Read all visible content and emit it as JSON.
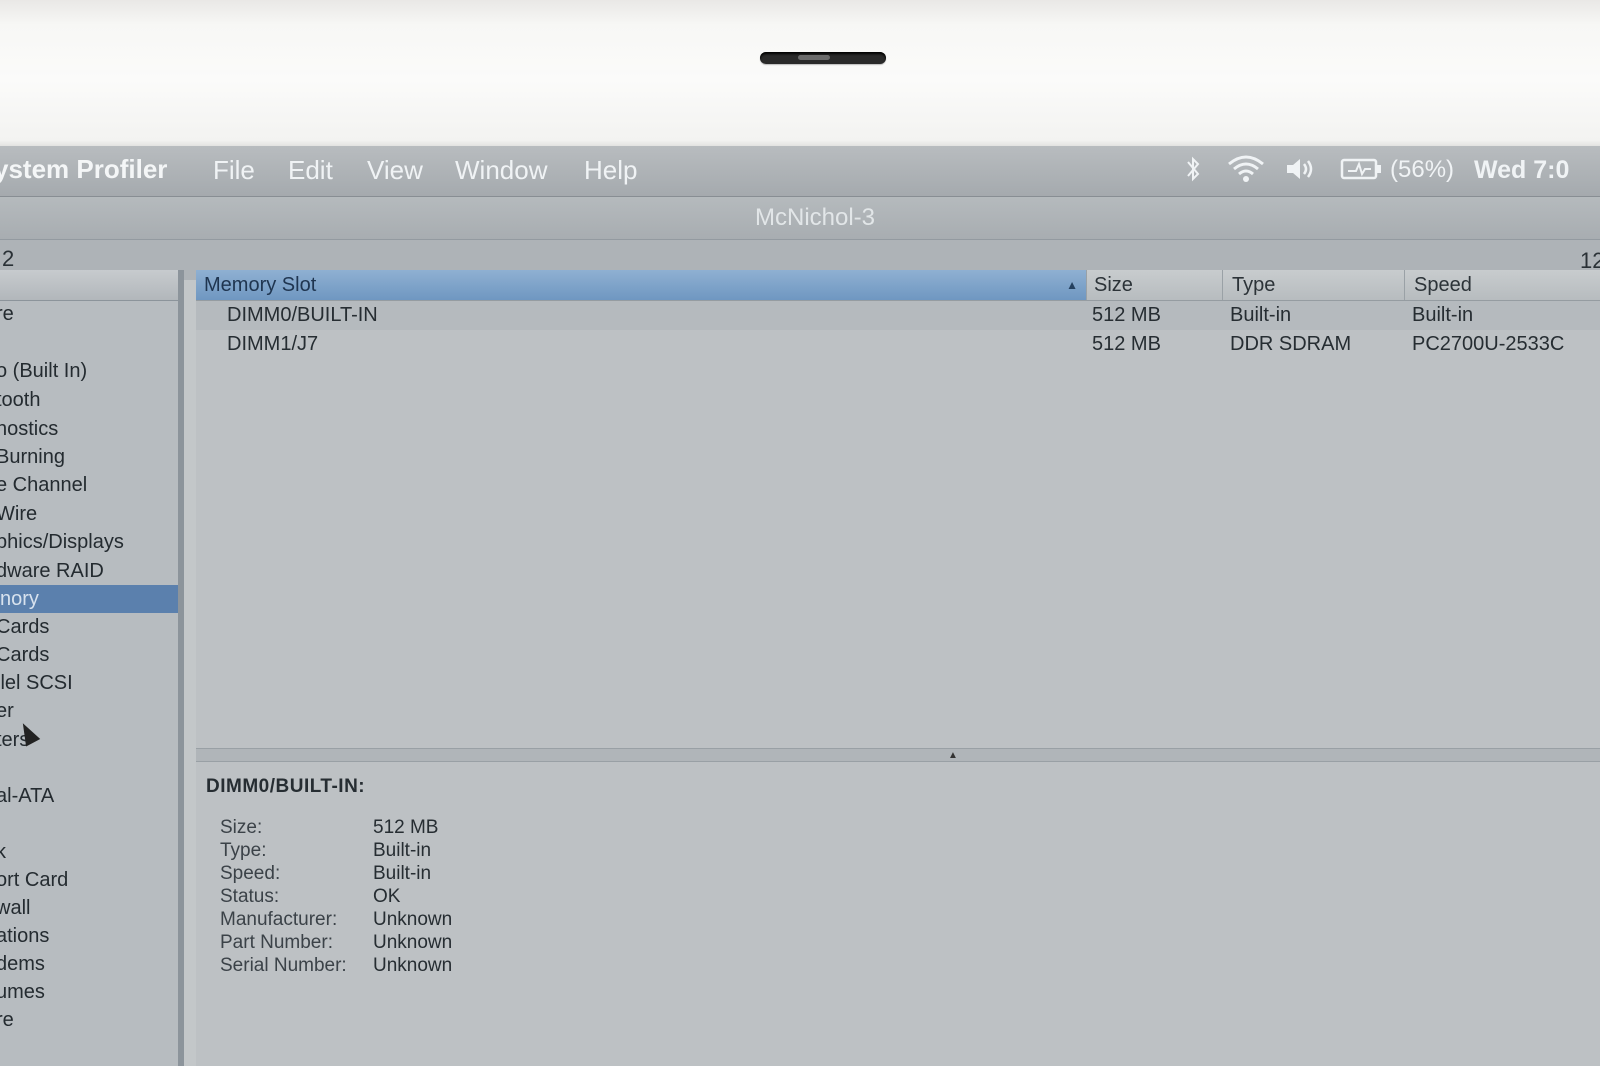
{
  "menubar": {
    "app_name": "ystem Profiler",
    "menus": [
      "File",
      "Edit",
      "View",
      "Window",
      "Help"
    ],
    "battery_percent": "(56%)",
    "clock": "Wed 7:0"
  },
  "window": {
    "title": "McNichol-3",
    "toolbar_left": "2",
    "toolbar_right": "12"
  },
  "sidebar": {
    "items": [
      "re",
      "o (Built In)",
      "tooth",
      "nostics",
      " Burning",
      "e Channel",
      "Wire",
      "phics/Displays",
      "dware RAID",
      "nory",
      "Cards",
      "Cards",
      "llel SCSI",
      "er",
      "ters",
      "al-ATA",
      "k",
      "ort Card",
      "wall",
      "ations",
      "dems",
      "umes",
      "re"
    ],
    "selected_index": 9
  },
  "table": {
    "columns": [
      "Memory Slot",
      "Size",
      "Type",
      "Speed"
    ],
    "rows": [
      {
        "slot": "DIMM0/BUILT-IN",
        "size": "512 MB",
        "type": "Built-in",
        "speed": "Built-in"
      },
      {
        "slot": "DIMM1/J7",
        "size": "512 MB",
        "type": "DDR SDRAM",
        "speed": "PC2700U-2533C"
      }
    ]
  },
  "detail": {
    "title": "DIMM0/BUILT-IN:",
    "fields": [
      {
        "key": "Size:",
        "value": "512 MB"
      },
      {
        "key": "Type:",
        "value": "Built-in"
      },
      {
        "key": "Speed:",
        "value": "Built-in"
      },
      {
        "key": "Status:",
        "value": "OK"
      },
      {
        "key": "Manufacturer:",
        "value": "Unknown"
      },
      {
        "key": "Part Number:",
        "value": "Unknown"
      },
      {
        "key": "Serial Number:",
        "value": "Unknown"
      }
    ]
  },
  "icons": {
    "bluetooth": "bluetooth-icon",
    "wifi": "wifi-icon",
    "volume": "volume-icon",
    "battery": "battery-icon"
  },
  "colors": {
    "selection": "#5b80ad",
    "sorted_header": "#7fa3c9"
  }
}
